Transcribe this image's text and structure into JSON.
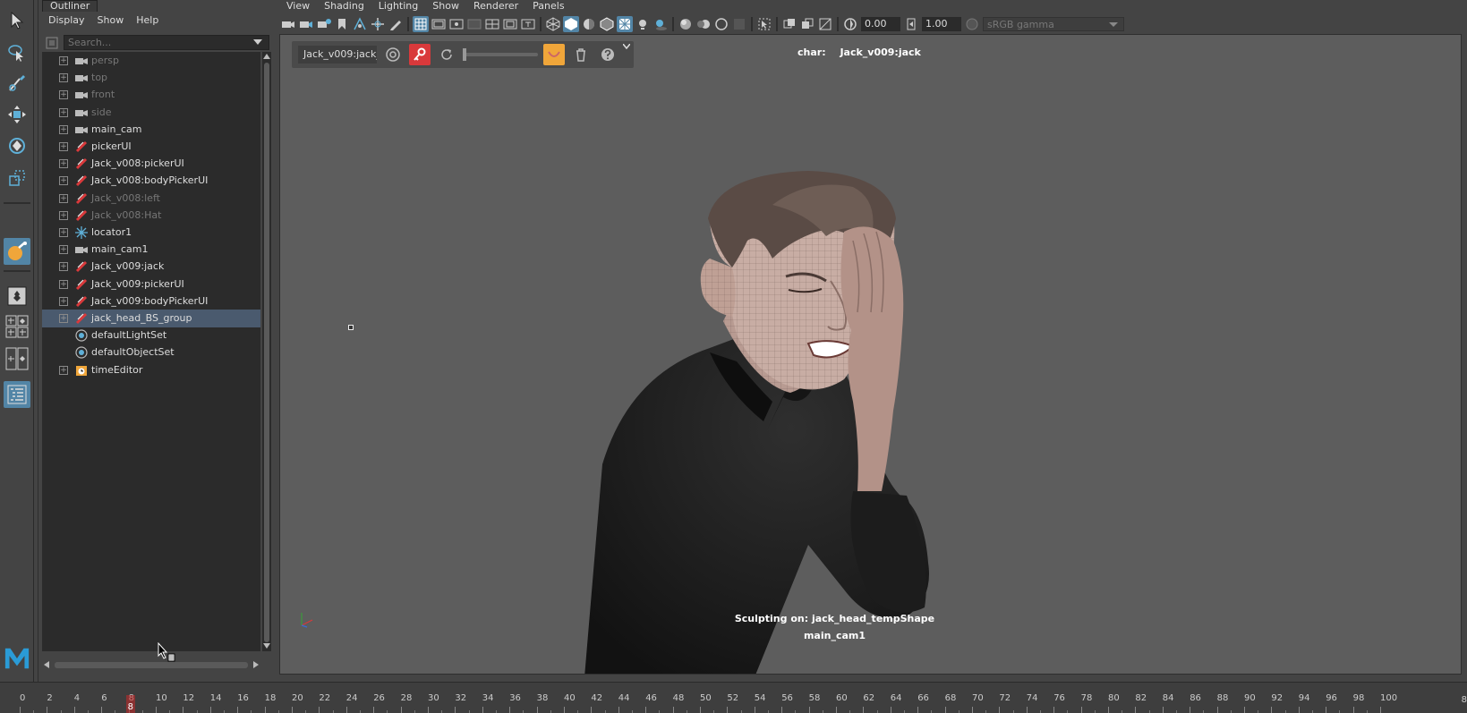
{
  "outliner": {
    "tab_title": "Outliner",
    "menu": [
      "Display",
      "Show",
      "Help"
    ],
    "search_placeholder": "Search...",
    "items": [
      {
        "label": "persp",
        "icon": "camera-icon",
        "dim": true
      },
      {
        "label": "top",
        "icon": "camera-icon",
        "dim": true
      },
      {
        "label": "front",
        "icon": "camera-icon",
        "dim": true
      },
      {
        "label": "side",
        "icon": "camera-icon",
        "dim": true
      },
      {
        "label": "main_cam",
        "icon": "camera-icon",
        "dim": false
      },
      {
        "label": "pickerUI",
        "icon": "curve-icon",
        "dim": false
      },
      {
        "label": "Jack_v008:pickerUI",
        "icon": "curve-icon",
        "dim": false
      },
      {
        "label": "Jack_v008:bodyPickerUI",
        "icon": "curve-icon",
        "dim": false
      },
      {
        "label": "Jack_v008:left",
        "icon": "curve-icon",
        "dim": true
      },
      {
        "label": "Jack_v008:Hat",
        "icon": "curve-icon",
        "dim": true
      },
      {
        "label": "locator1",
        "icon": "locator-icon",
        "dim": false
      },
      {
        "label": "main_cam1",
        "icon": "camera-icon",
        "dim": false
      },
      {
        "label": "Jack_v009:jack",
        "icon": "curve-icon",
        "dim": false
      },
      {
        "label": "Jack_v009:pickerUI",
        "icon": "curve-icon",
        "dim": false
      },
      {
        "label": "Jack_v009:bodyPickerUI",
        "icon": "curve-icon",
        "dim": false
      },
      {
        "label": "jack_head_BS_group",
        "icon": "curve-icon",
        "dim": false,
        "selected": true
      },
      {
        "label": "defaultLightSet",
        "icon": "set-icon",
        "dim": false,
        "no_expander": true
      },
      {
        "label": "defaultObjectSet",
        "icon": "set-icon",
        "dim": false,
        "no_expander": true
      },
      {
        "label": "timeEditor",
        "icon": "time-editor-icon",
        "dim": false
      }
    ]
  },
  "viewport": {
    "menu": [
      "View",
      "Shading",
      "Lighting",
      "Show",
      "Renderer",
      "Panels"
    ],
    "exposure": "0.00",
    "gamma": "1.00",
    "color_space": "sRGB gamma",
    "sculpt_target": "Jack_v009:jack_",
    "hud_char_key": "char:",
    "hud_char_value": "Jack_v009:jack",
    "hud_sculpting": "Sculpting on: jack_head_tempShape",
    "hud_camera": "main_cam1"
  },
  "timeline": {
    "labels": [
      "0",
      "2",
      "4",
      "6",
      "8",
      "10",
      "12",
      "14",
      "16",
      "18",
      "20",
      "22",
      "24",
      "26",
      "28",
      "30",
      "32",
      "34",
      "36",
      "38",
      "40",
      "42",
      "44",
      "46",
      "48",
      "50",
      "52",
      "54",
      "56",
      "58",
      "60",
      "62",
      "64",
      "66",
      "68",
      "70",
      "72",
      "74",
      "76",
      "78",
      "80",
      "82",
      "84",
      "86",
      "88",
      "90",
      "92",
      "94",
      "96",
      "98",
      "100"
    ],
    "current_frame": "8",
    "end_label": "8"
  },
  "colors": {
    "accent_blue": "#5285a6",
    "key_red": "#d9393b",
    "falloff_orange": "#f0a63a",
    "selection_row": "#4a5a6e"
  }
}
